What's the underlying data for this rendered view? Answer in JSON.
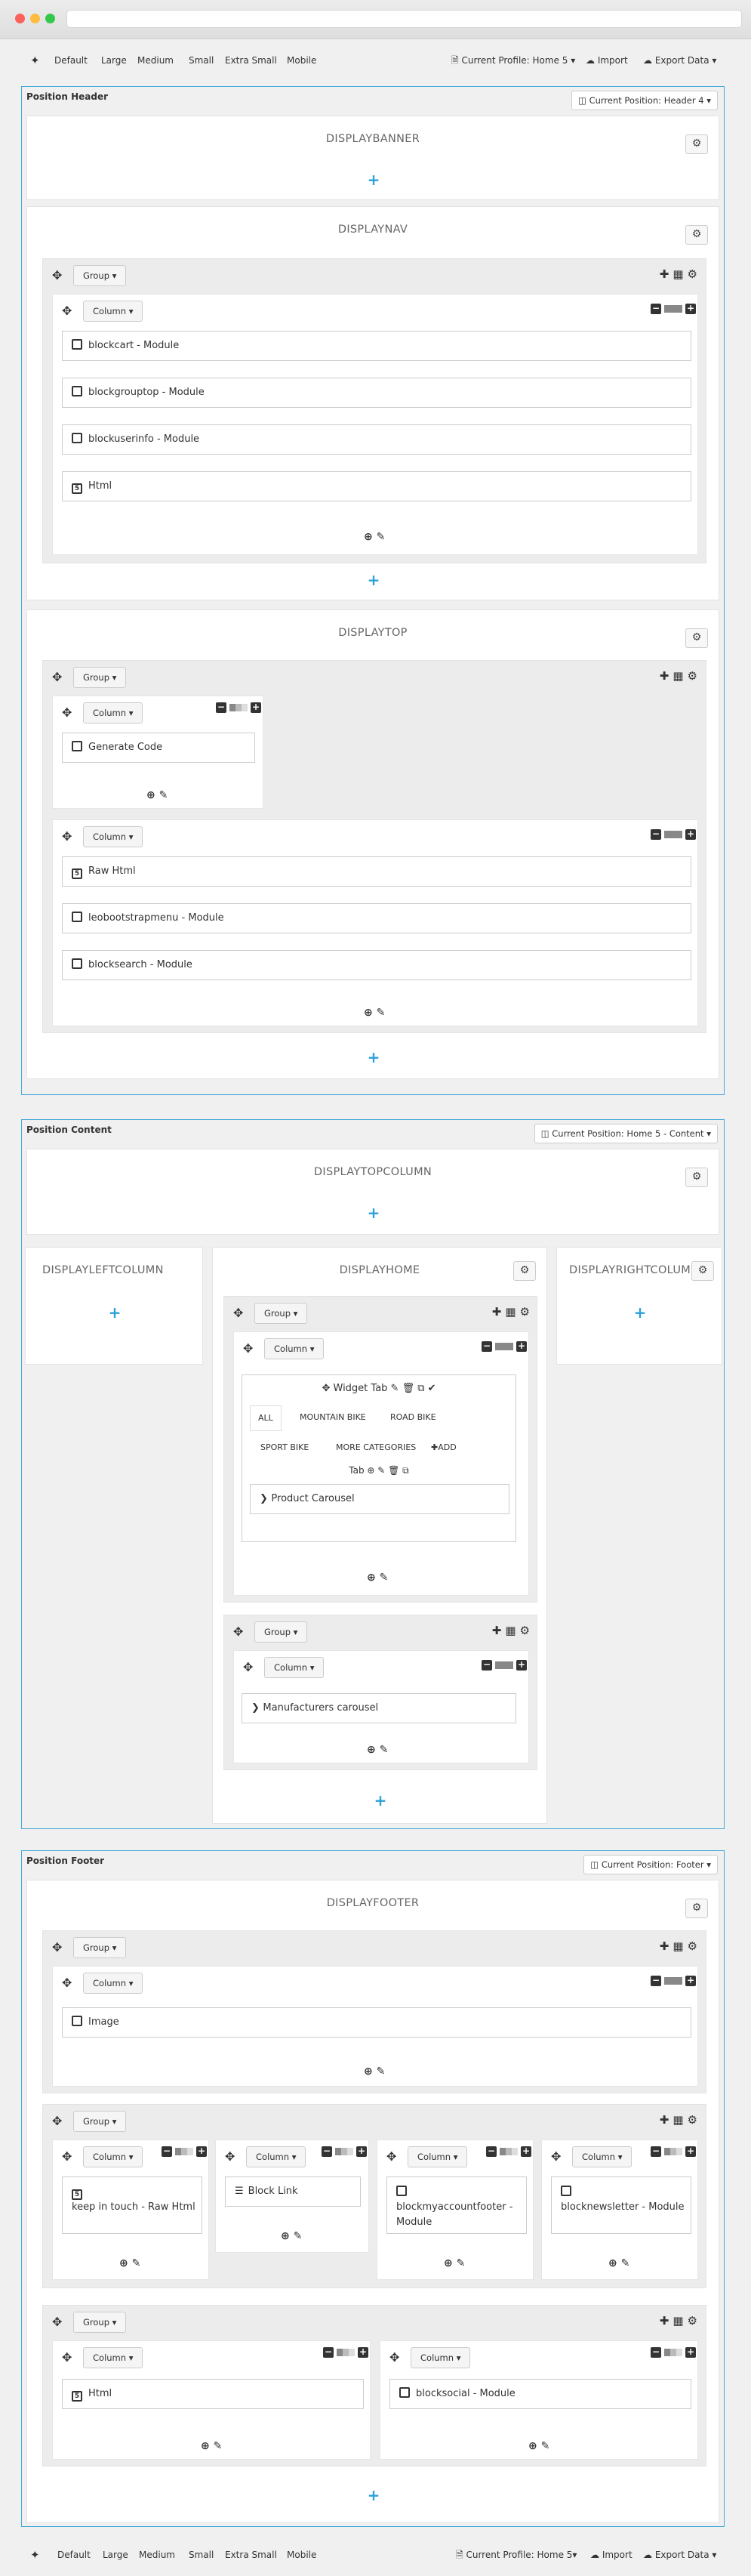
{
  "toolbar": {
    "items": [
      "Default",
      "Large",
      "Medium",
      "Small",
      "Extra Small",
      "Mobile"
    ],
    "profile": "Current Profile: Home 5",
    "profile_bottom": "Current Profile: Home 5",
    "import": "Import",
    "export": "Export Data"
  },
  "header": {
    "title": "Position Header",
    "current_position": "Current Position: Header 4",
    "displaybanner": "DISPLAYBANNER",
    "displaynav": "DISPLAYNAV",
    "displaytop": "DISPLAYTOP",
    "group_label": "Group",
    "column_label": "Column",
    "nav_modules": [
      "blockcart - Module",
      "blockgrouptop - Module",
      "blockuserinfo - Module",
      "Html"
    ],
    "top_col1_modules": [
      "Generate Code"
    ],
    "top_col2_modules": [
      "Raw Html",
      "leobootstrapmenu - Module",
      "blocksearch - Module"
    ]
  },
  "content": {
    "title": "Position Content",
    "current_position": "Current Position: Home 5 - Content",
    "displaytopcolumn": "DISPLAYTOPCOLUMN",
    "displayleftcolumn": "DISPLAYLEFTCOLUMN",
    "displayhome": "DISPLAYHOME",
    "displayrightcolumn": "DISPLAYRIGHTCOLUMN",
    "widget_tab": "Widget Tab",
    "tabs": [
      "ALL",
      "MOUNTAIN BIKE",
      "ROAD BIKE",
      "SPORT BIKE",
      "MORE CATEGORIES"
    ],
    "add_label": "ADD",
    "tab_label": "Tab",
    "product_carousel": "Product Carousel",
    "manufacturers_carousel": "Manufacturers carousel"
  },
  "footer": {
    "title": "Position Footer",
    "current_position": "Current Position: Footer",
    "displayfooter": "DISPLAYFOOTER",
    "image": "Image",
    "row2": [
      "keep in touch - Raw Html",
      "Block Link",
      "blockmyaccountfooter - Module",
      "blocknewsletter - Module"
    ],
    "row3": [
      "Html",
      "blocksocial - Module"
    ]
  },
  "colors": {
    "accent": "#2aa0d8",
    "border": "#44a9da"
  }
}
